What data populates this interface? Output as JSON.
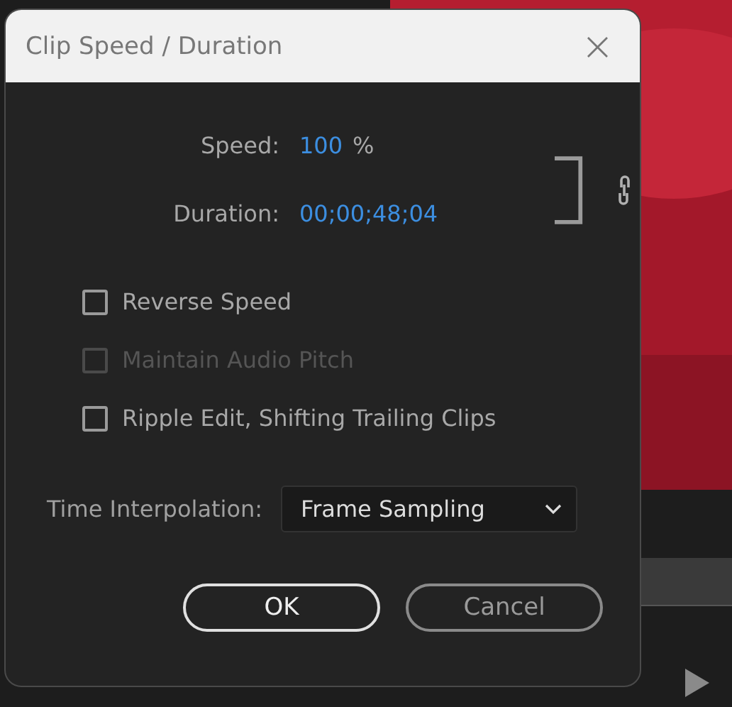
{
  "window": {
    "title": "Clip Speed / Duration",
    "close": "×"
  },
  "speed": {
    "label": "Speed:",
    "value": "100",
    "unit": "%"
  },
  "duration": {
    "label": "Duration:",
    "value": "00;00;48;04"
  },
  "options": [
    {
      "label": "Reverse Speed",
      "checked": false,
      "disabled": false
    },
    {
      "label": "Maintain Audio Pitch",
      "checked": false,
      "disabled": true
    },
    {
      "label": "Ripple Edit, Shifting Trailing Clips",
      "checked": false,
      "disabled": false
    }
  ],
  "interpolation": {
    "label": "Time Interpolation:",
    "value": "Frame Sampling"
  },
  "buttons": [
    {
      "label": "OK",
      "kind": "default"
    },
    {
      "label": "Cancel",
      "kind": "secondary"
    }
  ]
}
